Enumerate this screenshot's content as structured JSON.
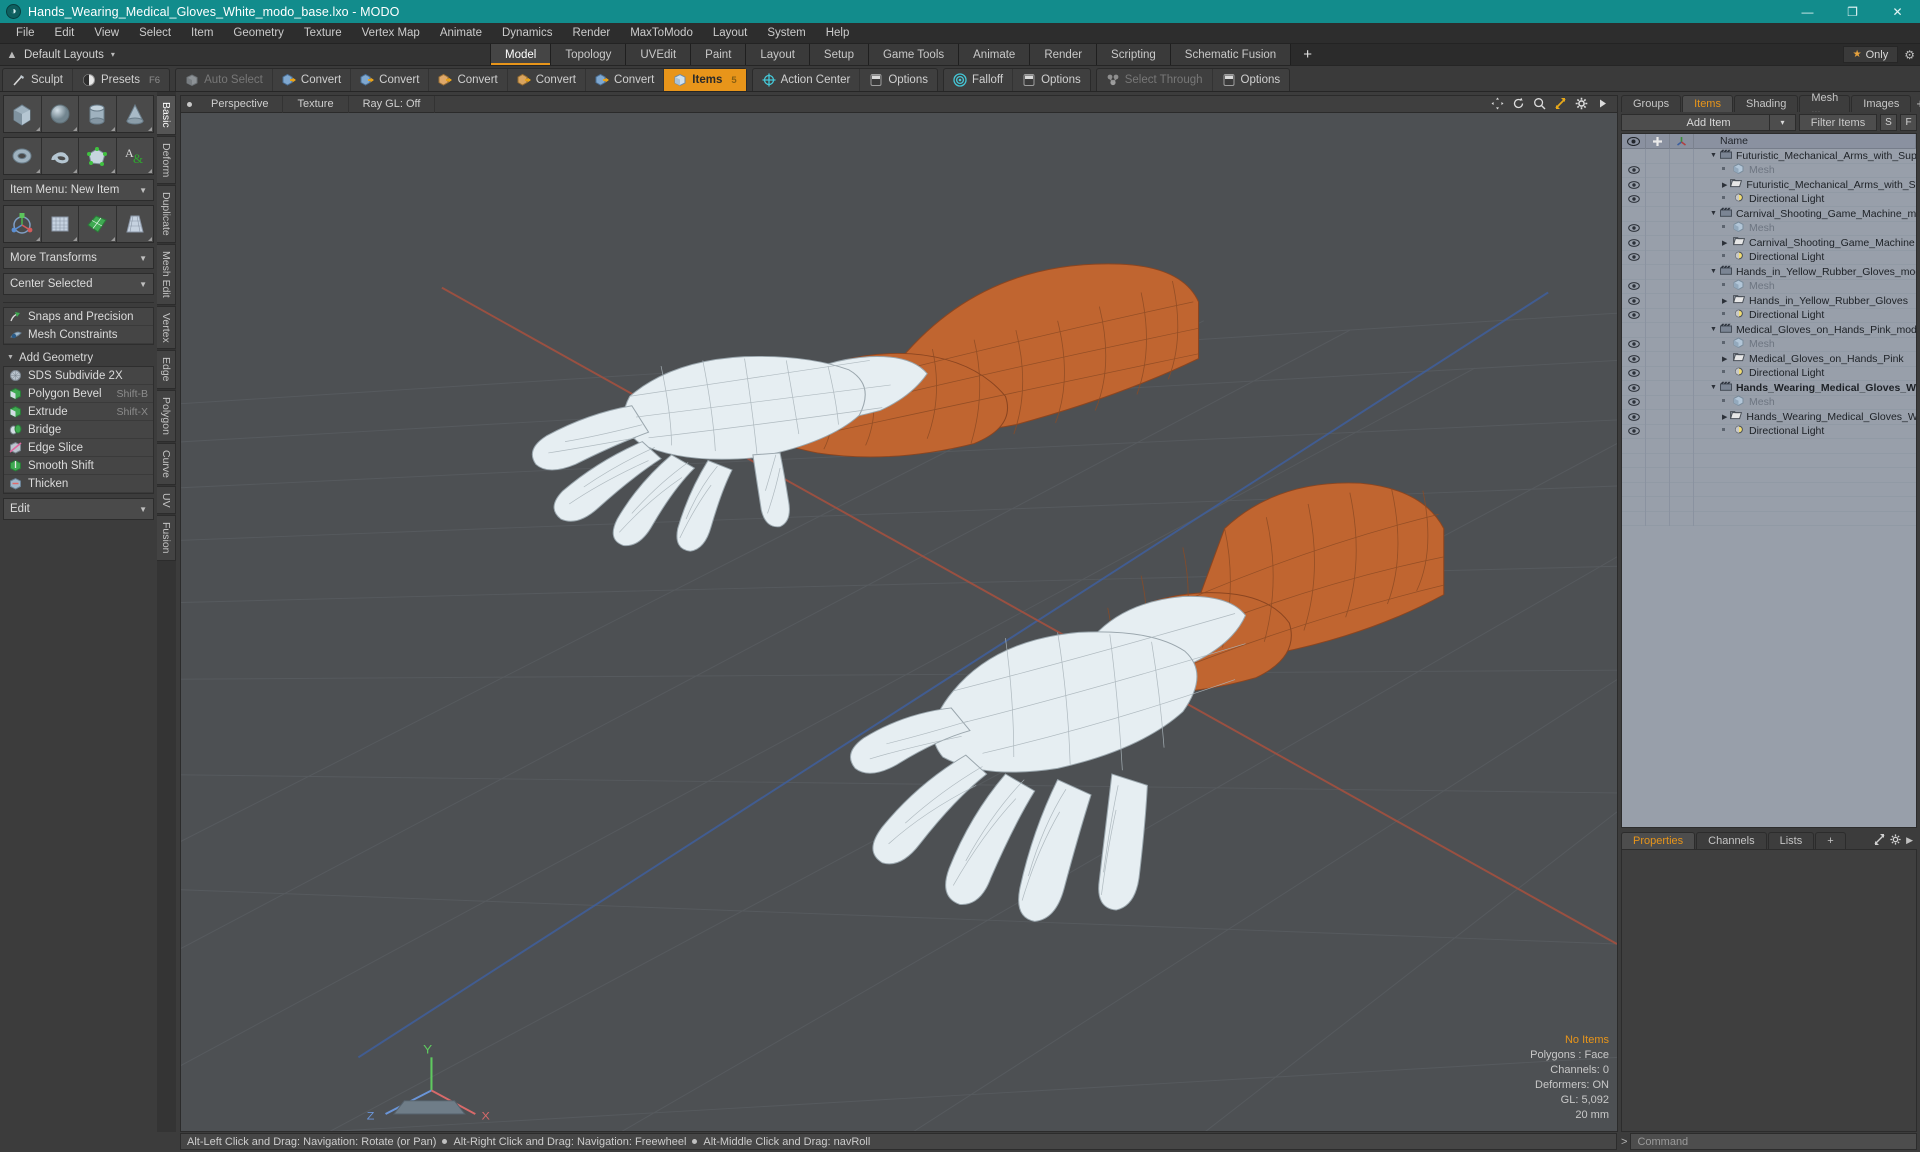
{
  "titlebar": {
    "title": "Hands_Wearing_Medical_Gloves_White_modo_base.lxo - MODO",
    "logo_glyph": "◑",
    "minimize": "—",
    "maximize": "❐",
    "close": "✕"
  },
  "menubar": {
    "items": [
      "File",
      "Edit",
      "View",
      "Select",
      "Item",
      "Geometry",
      "Texture",
      "Vertex Map",
      "Animate",
      "Dynamics",
      "Render",
      "MaxToModo",
      "Layout",
      "System",
      "Help"
    ]
  },
  "layoutbar": {
    "default_layouts": "Default Layouts",
    "caret": "▾",
    "tabs": [
      {
        "label": "Model",
        "active": true
      },
      {
        "label": "Topology",
        "active": false
      },
      {
        "label": "UVEdit",
        "active": false
      },
      {
        "label": "Paint",
        "active": false
      },
      {
        "label": "Layout",
        "active": false
      },
      {
        "label": "Setup",
        "active": false
      },
      {
        "label": "Game Tools",
        "active": false
      },
      {
        "label": "Animate",
        "active": false
      },
      {
        "label": "Render",
        "active": false
      },
      {
        "label": "Scripting",
        "active": false
      },
      {
        "label": "Schematic Fusion",
        "active": false
      }
    ],
    "plus": "+",
    "only_label": "Only",
    "star": "★",
    "gear": "⚙"
  },
  "modebar": {
    "groups": [
      {
        "buttons": [
          {
            "label": "Sculpt",
            "icon": "brush-icon",
            "state": "normal",
            "key": ""
          },
          {
            "label": "Presets",
            "icon": "sphere-half-icon",
            "state": "normal",
            "key": "F6"
          }
        ]
      },
      {
        "buttons": [
          {
            "label": "Auto Select",
            "icon": "cube-grey-icon",
            "state": "dim",
            "key": ""
          },
          {
            "label": "Convert",
            "icon": "vertex-convert-icon",
            "state": "normal",
            "key": ""
          },
          {
            "label": "Convert",
            "icon": "edge-convert-icon",
            "state": "normal",
            "key": ""
          },
          {
            "label": "Convert",
            "icon": "polygon-convert-icon",
            "state": "normal",
            "key": ""
          },
          {
            "label": "Convert",
            "icon": "material-convert-icon",
            "state": "normal",
            "key": ""
          },
          {
            "label": "Convert",
            "icon": "item-convert-icon",
            "state": "normal",
            "key": ""
          },
          {
            "label": "Items",
            "icon": "items-cube-icon",
            "state": "selected",
            "key": "5"
          }
        ]
      },
      {
        "buttons": [
          {
            "label": "Action Center",
            "icon": "crosshair-icon",
            "state": "normal",
            "key": ""
          },
          {
            "label": "Options",
            "icon": "checkbox-icon",
            "state": "normal",
            "key": ""
          }
        ]
      },
      {
        "buttons": [
          {
            "label": "Falloff",
            "icon": "falloff-target-icon",
            "state": "normal",
            "key": ""
          },
          {
            "label": "Options",
            "icon": "checkbox-icon",
            "state": "normal",
            "key": ""
          }
        ]
      },
      {
        "buttons": [
          {
            "label": "Select Through",
            "icon": "select-through-icon",
            "state": "dim",
            "key": ""
          },
          {
            "label": "Options",
            "icon": "checkbox-icon",
            "state": "normal",
            "key": ""
          }
        ]
      }
    ]
  },
  "toolbox": {
    "primitives_row1": [
      "cube-tool-icon",
      "sphere-tool-icon",
      "cylinder-tool-icon",
      "cone-tool-icon"
    ],
    "primitives_row2": [
      "torus-tool-icon",
      "spiral-tool-icon",
      "polygon-tool-icon",
      "text-tool-icon"
    ],
    "item_menu": "Item Menu: New Item",
    "transform_row": [
      "transform-gizmo-icon",
      "bend-mesh-icon",
      "deform-mesh-icon",
      "taper-mesh-icon"
    ],
    "more_transforms": "More Transforms",
    "center_selected": "Center Selected",
    "snaps": {
      "label": "Snaps and Precision",
      "icon": "snap-magnet-icon"
    },
    "mesh_constraints": {
      "label": "Mesh Constraints",
      "icon": "constraint-icon"
    },
    "add_geometry_header": "Add Geometry",
    "geometry_items": [
      {
        "label": "SDS Subdivide 2X",
        "icon": "sds-sphere-icon",
        "shortcut": ""
      },
      {
        "label": "Polygon Bevel",
        "icon": "bevel-cube-icon",
        "shortcut": "Shift-B"
      },
      {
        "label": "Extrude",
        "icon": "extrude-cube-icon",
        "shortcut": "Shift-X"
      },
      {
        "label": "Bridge",
        "icon": "bridge-icon",
        "shortcut": ""
      },
      {
        "label": "Edge Slice",
        "icon": "edge-slice-icon",
        "shortcut": ""
      },
      {
        "label": "Smooth Shift",
        "icon": "smooth-shift-icon",
        "shortcut": ""
      },
      {
        "label": "Thicken",
        "icon": "thicken-icon",
        "shortcut": ""
      }
    ],
    "edit_dropdown": "Edit",
    "vertical_tabs": [
      {
        "label": "Basic",
        "active": true
      },
      {
        "label": "Deform",
        "active": false
      },
      {
        "label": "Duplicate",
        "active": false
      },
      {
        "label": "Mesh Edit",
        "active": false
      },
      {
        "label": "Vertex",
        "active": false
      },
      {
        "label": "Edge",
        "active": false
      },
      {
        "label": "Polygon",
        "active": false
      },
      {
        "label": "Curve",
        "active": false
      },
      {
        "label": "UV",
        "active": false
      },
      {
        "label": "Fusion",
        "active": false
      }
    ]
  },
  "viewport": {
    "header": {
      "view_name": "Perspective",
      "shading": "Texture",
      "raygl": "Ray GL: Off",
      "icons": [
        "move-view-icon",
        "rotate-view-icon",
        "zoom-view-icon",
        "fit-view-icon",
        "viewport-gear-icon",
        "viewport-arrow-icon"
      ]
    },
    "stats": {
      "selection": "No Items",
      "polygons": "Polygons : Face",
      "channels": "Channels: 0",
      "deformers": "Deformers: ON",
      "gl": "GL: 5,092",
      "grid": "20 mm"
    },
    "axis_labels": {
      "y": "Y",
      "x": "X",
      "z": "Z"
    },
    "colors": {
      "background": "#4d5053",
      "grid": "#5a5e62",
      "axis_x": "#b0564a",
      "axis_z": "#4a6fb0",
      "glove": "#e3ebef",
      "sleeve": "#c0652f",
      "wire": "#7f8a91"
    }
  },
  "rightpanel": {
    "tabs": [
      {
        "label": "Groups",
        "active": false
      },
      {
        "label": "Items",
        "active": true
      },
      {
        "label": "Shading",
        "active": false
      },
      {
        "label": "Mesh ...",
        "active": false
      },
      {
        "label": "Images",
        "active": false
      }
    ],
    "tab_icons": [
      "plus-icon",
      "expand-icon",
      "gear-icon",
      "arrow-right-icon"
    ],
    "add_item": "Add Item",
    "add_item_caret": "▾",
    "filter_placeholder": "Filter Items",
    "btn_s": "S",
    "btn_f": "F",
    "columns": [
      "eye-icon",
      "plus-icon",
      "axis-icon",
      "Name"
    ],
    "name_header": "Name",
    "rows": [
      {
        "level": 0,
        "label": "Futuristic_Mechanical_Arms_with_Supply_ ...",
        "icon": "scene-clapper-icon",
        "disclosure": "down",
        "eye": false,
        "bold": false,
        "ghost": false
      },
      {
        "level": 1,
        "label": "Mesh",
        "icon": "mesh-cube-icon",
        "disclosure": "leaf",
        "eye": true,
        "bold": false,
        "ghost": true
      },
      {
        "level": 1,
        "label": "Futuristic_Mechanical_Arms_with_Suppl ...",
        "icon": "group-folder-icon",
        "disclosure": "right",
        "eye": true,
        "bold": false,
        "ghost": false
      },
      {
        "level": 1,
        "label": "Directional Light",
        "icon": "light-icon",
        "disclosure": "leaf",
        "eye": true,
        "bold": false,
        "ghost": false
      },
      {
        "level": 0,
        "label": "Carnival_Shooting_Game_Machine_modo_ ...",
        "icon": "scene-clapper-icon",
        "disclosure": "down",
        "eye": false,
        "bold": false,
        "ghost": false
      },
      {
        "level": 1,
        "label": "Mesh",
        "icon": "mesh-cube-icon",
        "disclosure": "leaf",
        "eye": true,
        "bold": false,
        "ghost": true
      },
      {
        "level": 1,
        "label": "Carnival_Shooting_Game_Machine",
        "icon": "group-folder-icon",
        "disclosure": "right",
        "eye": true,
        "bold": false,
        "ghost": false
      },
      {
        "level": 1,
        "label": "Directional Light",
        "icon": "light-icon",
        "disclosure": "leaf",
        "eye": true,
        "bold": false,
        "ghost": false
      },
      {
        "level": 0,
        "label": "Hands_in_Yellow_Rubber_Gloves_modo_b ...",
        "icon": "scene-clapper-icon",
        "disclosure": "down",
        "eye": false,
        "bold": false,
        "ghost": false
      },
      {
        "level": 1,
        "label": "Mesh",
        "icon": "mesh-cube-icon",
        "disclosure": "leaf",
        "eye": true,
        "bold": false,
        "ghost": true
      },
      {
        "level": 1,
        "label": "Hands_in_Yellow_Rubber_Gloves",
        "icon": "group-folder-icon",
        "disclosure": "right",
        "eye": true,
        "bold": false,
        "ghost": false
      },
      {
        "level": 1,
        "label": "Directional Light",
        "icon": "light-icon",
        "disclosure": "leaf",
        "eye": true,
        "bold": false,
        "ghost": false
      },
      {
        "level": 0,
        "label": "Medical_Gloves_on_Hands_Pink_modo_bas...",
        "icon": "scene-clapper-icon",
        "disclosure": "down",
        "eye": false,
        "bold": false,
        "ghost": false
      },
      {
        "level": 1,
        "label": "Mesh",
        "icon": "mesh-cube-icon",
        "disclosure": "leaf",
        "eye": true,
        "bold": false,
        "ghost": true
      },
      {
        "level": 1,
        "label": "Medical_Gloves_on_Hands_Pink",
        "icon": "group-folder-icon",
        "disclosure": "right",
        "eye": true,
        "bold": false,
        "ghost": false
      },
      {
        "level": 1,
        "label": "Directional Light",
        "icon": "light-icon",
        "disclosure": "leaf",
        "eye": true,
        "bold": false,
        "ghost": false
      },
      {
        "level": 0,
        "label": "Hands_Wearing_Medical_Gloves_W ...",
        "icon": "scene-clapper-icon",
        "disclosure": "down",
        "eye": true,
        "bold": true,
        "ghost": false
      },
      {
        "level": 1,
        "label": "Mesh",
        "icon": "mesh-cube-icon",
        "disclosure": "leaf",
        "eye": true,
        "bold": false,
        "ghost": true
      },
      {
        "level": 1,
        "label": "Hands_Wearing_Medical_Gloves_White",
        "icon": "group-folder-icon",
        "disclosure": "right",
        "eye": true,
        "bold": false,
        "ghost": false
      },
      {
        "level": 1,
        "label": "Directional Light",
        "icon": "light-icon",
        "disclosure": "leaf",
        "eye": true,
        "bold": false,
        "ghost": false
      }
    ],
    "properties_tabs": [
      {
        "label": "Properties",
        "active": true
      },
      {
        "label": "Channels",
        "active": false
      },
      {
        "label": "Lists",
        "active": false
      },
      {
        "label": "+",
        "active": false
      }
    ],
    "properties_icons": [
      "expand-icon",
      "gear-icon",
      "arrow-right-icon"
    ]
  },
  "statusbar": {
    "hints": [
      "Alt-Left Click and Drag: Navigation: Rotate (or Pan)",
      "Alt-Right Click and Drag: Navigation: Freewheel",
      "Alt-Middle Click and Drag: navRoll"
    ],
    "command_prompt": ">",
    "command_placeholder": "Command"
  }
}
